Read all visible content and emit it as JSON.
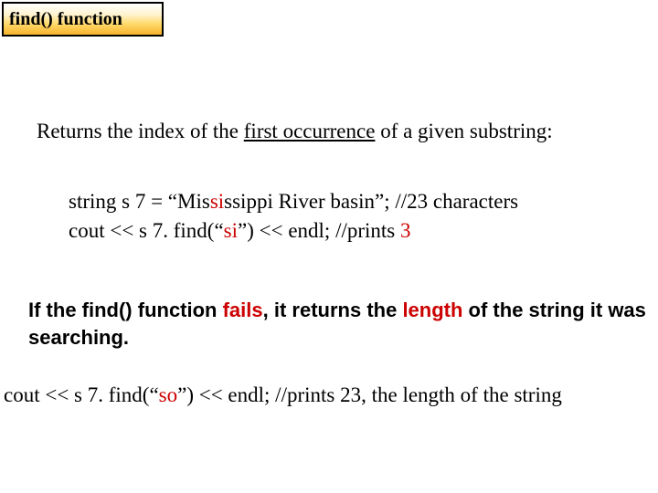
{
  "titleBox": "find() function",
  "intro": {
    "p1": "Returns the index of the ",
    "underlined": "first occurrence",
    "p2": " of a given substring:"
  },
  "code1": {
    "l1a": "string s 7 = “Mis",
    "l1r": "si",
    "l1b": "ssippi River basin”;   //23 characters",
    "l2a": "cout << s 7. find(“",
    "l2r": "si",
    "l2b": "”) << endl;   //prints ",
    "l2c": "3"
  },
  "fails": {
    "p1": " If the find() function ",
    "r1": "fails",
    "p2": ", it returns the ",
    "r2": "length",
    "p3": " of the string it was searching."
  },
  "code2": {
    "a": "cout << s 7. find(“",
    "r": "so",
    "b": "”) << endl;  //prints 23, the length of the string"
  }
}
